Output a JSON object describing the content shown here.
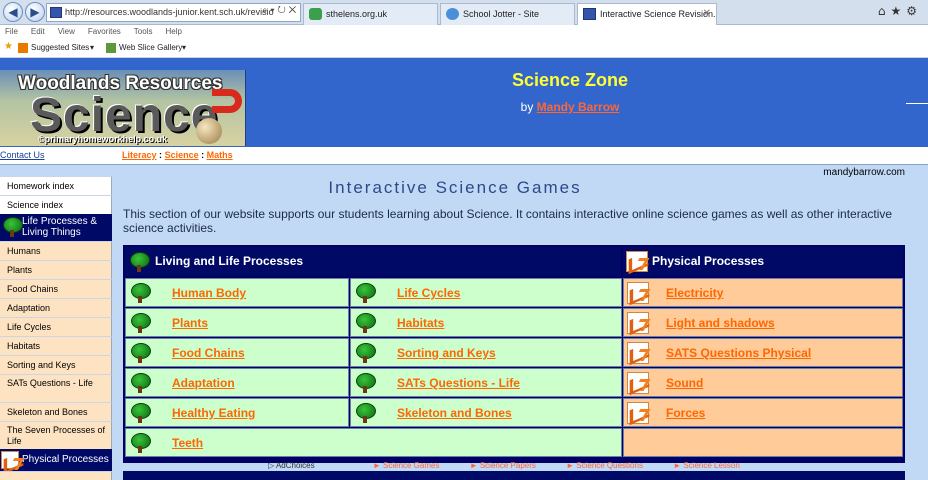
{
  "browser": {
    "address": "http://resources.woodlands-junior.kent.sch.uk/revisio",
    "tabs": [
      {
        "label": "sthelens.org.uk"
      },
      {
        "label": "School Jotter - Site"
      },
      {
        "label": "Interactive Science Revision..."
      }
    ],
    "menu": [
      "File",
      "Edit",
      "View",
      "Favorites",
      "Tools",
      "Help"
    ],
    "favorites": {
      "suggested": "Suggested Sites",
      "webslice": "Web Slice Gallery"
    }
  },
  "header": {
    "banner_line1": "Woodlands Resources",
    "banner_line2": "Science",
    "banner_line3": "©primaryhomeworkhelp.co.uk",
    "title": "Science Zone",
    "by_prefix": "by",
    "author": "Mandy Barrow"
  },
  "subnav": {
    "contact": "Contact Us",
    "crumbs": [
      "Literacy",
      "Science",
      "Maths"
    ],
    "separator": ":"
  },
  "sidebar": {
    "top_items": [
      "Homework index",
      "Science index"
    ],
    "life_heading": "Life Processes & Living Things",
    "life_items": [
      "Humans",
      "Plants",
      "Food Chains",
      "Adaptation",
      "Life Cycles",
      "Habitats",
      "Sorting and Keys",
      "SATs Questions - Life",
      "Skeleton and Bones",
      "The Seven Processes of Life"
    ],
    "physical_heading": "Physical Processes"
  },
  "main": {
    "site_name": "mandybarrow.com",
    "title": "Interactive Science Games",
    "intro": "This section of our website supports our students learning about Science. It contains interactive online science games as well as other interactive science activities."
  },
  "table": {
    "life_header": "Living and Life Processes",
    "physical_header": "Physical Processes",
    "life_col1": [
      "Human Body",
      "Plants",
      "Food Chains",
      "Adaptation",
      "Healthy Eating",
      "Teeth"
    ],
    "life_col2": [
      "Life Cycles",
      "Habitats",
      "Sorting and Keys",
      "SATs Questions - Life",
      "Skeleton and Bones"
    ],
    "physical": [
      "Electricity",
      "Light and shadows",
      "SATS Questions Physical",
      "Sound",
      "Forces"
    ]
  },
  "ads": {
    "label": "AdChoices",
    "links": [
      "Science Games",
      "Science Papers",
      "Science Questions",
      "Science Lesson"
    ]
  },
  "colors": {
    "header_blue": "#3366cc",
    "navy": "#000a66",
    "link_orange": "#ff6600",
    "title_yellow": "#ffff33",
    "green_cell": "#ccffcc",
    "orange_cell": "#ffcc99"
  }
}
